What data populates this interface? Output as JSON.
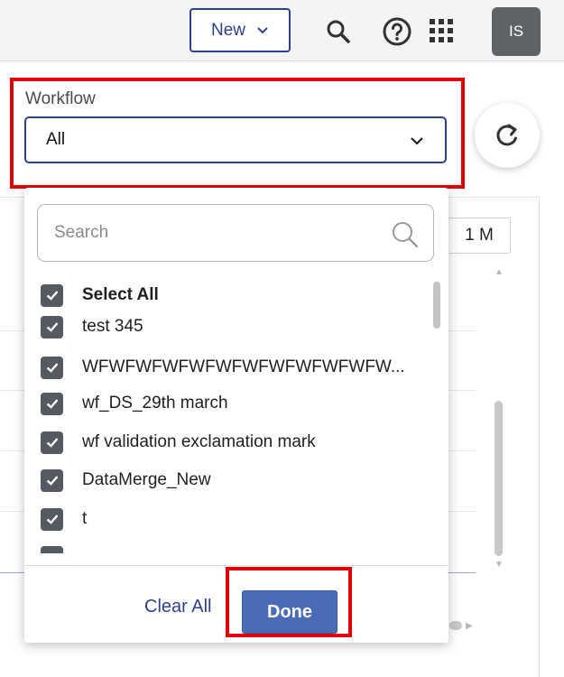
{
  "header": {
    "new_label": "New",
    "avatar_initials": "IS",
    "icons": [
      "chevron-down-icon",
      "search-icon",
      "help-icon",
      "apps-grid-icon"
    ]
  },
  "background": {
    "range_button": "1 M"
  },
  "workflow": {
    "label": "Workflow",
    "selected": "All"
  },
  "dropdown": {
    "search_placeholder": "Search",
    "items": [
      {
        "label": "Select All",
        "checked": true
      },
      {
        "label": "test 345",
        "checked": true
      },
      {
        "label": "WFWFWFWFWFWFWFWFWFWFWFW...",
        "checked": true
      },
      {
        "label": "wf_DS_29th march",
        "checked": true
      },
      {
        "label": "wf validation exclamation mark",
        "checked": true
      },
      {
        "label": "DataMerge_New",
        "checked": true
      },
      {
        "label": "t",
        "checked": true
      }
    ],
    "clear_label": "Clear All",
    "done_label": "Done"
  },
  "colors": {
    "accent": "#2f3f8f",
    "done_button": "#4a6bb6",
    "highlight": "#e10000",
    "checkbox": "#555a60"
  }
}
